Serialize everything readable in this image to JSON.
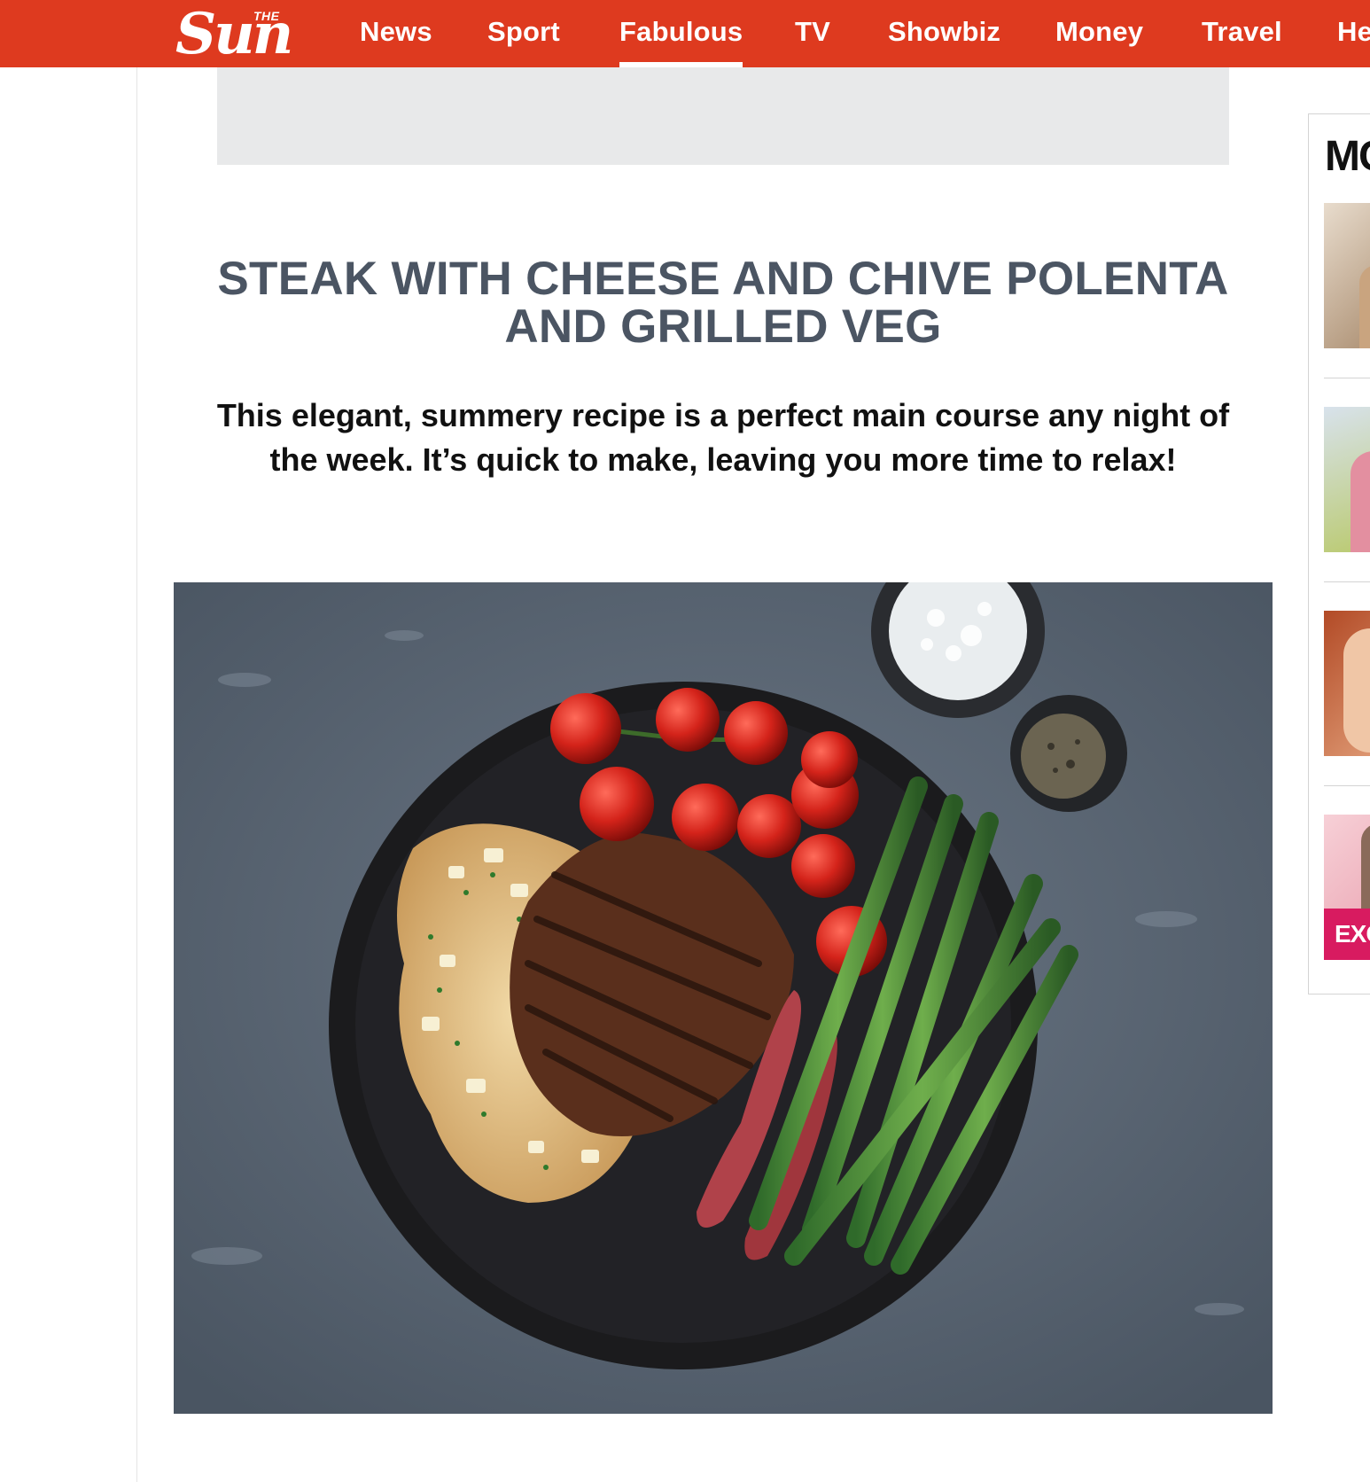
{
  "site": {
    "logo_the": "THE",
    "logo_sun": "Sun",
    "brand_color": "#de3a1f"
  },
  "nav": {
    "items": [
      {
        "label": "News"
      },
      {
        "label": "Sport"
      },
      {
        "label": "Fabulous",
        "active": true
      },
      {
        "label": "TV"
      },
      {
        "label": "Showbiz"
      },
      {
        "label": "Money"
      },
      {
        "label": "Travel"
      },
      {
        "label": "He"
      }
    ]
  },
  "article": {
    "headline": "STEAK WITH CHEESE AND CHIVE POLENTA AND GRILLED VEG",
    "standfirst": "This elegant, summery recipe is a perfect main course any night of the week. It’s quick to make, leaving you more time to relax!"
  },
  "rail": {
    "title": "MC",
    "badge": "EXC",
    "thumb_icons": [
      "person-photo",
      "person-photo",
      "person-photo",
      "person-photo"
    ]
  }
}
